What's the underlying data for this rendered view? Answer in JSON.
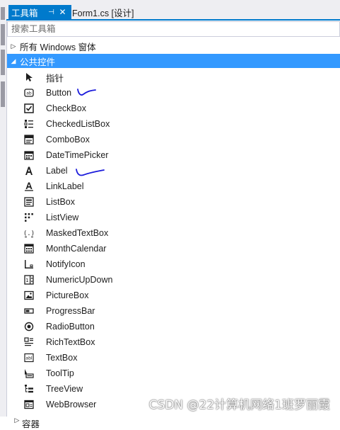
{
  "window": {
    "active_tab": "工具箱",
    "pin_glyph": "⊣",
    "close_glyph": "✕",
    "doc_tab": "Form1.cs [设计]"
  },
  "search": {
    "placeholder": "搜索工具箱"
  },
  "groups": {
    "all_windows": "所有 Windows 窗体",
    "common": "公共控件"
  },
  "items": [
    {
      "label": "指针",
      "icon": "pointer-icon"
    },
    {
      "label": "Button",
      "icon": "button-icon"
    },
    {
      "label": "CheckBox",
      "icon": "checkbox-icon"
    },
    {
      "label": "CheckedListBox",
      "icon": "checkedlistbox-icon"
    },
    {
      "label": "ComboBox",
      "icon": "combobox-icon"
    },
    {
      "label": "DateTimePicker",
      "icon": "datetimepicker-icon"
    },
    {
      "label": "Label",
      "icon": "label-icon"
    },
    {
      "label": "LinkLabel",
      "icon": "linklabel-icon"
    },
    {
      "label": "ListBox",
      "icon": "listbox-icon"
    },
    {
      "label": "ListView",
      "icon": "listview-icon"
    },
    {
      "label": "MaskedTextBox",
      "icon": "maskedtextbox-icon"
    },
    {
      "label": "MonthCalendar",
      "icon": "monthcalendar-icon"
    },
    {
      "label": "NotifyIcon",
      "icon": "notifyicon-icon"
    },
    {
      "label": "NumericUpDown",
      "icon": "numericupdown-icon"
    },
    {
      "label": "PictureBox",
      "icon": "picturebox-icon"
    },
    {
      "label": "ProgressBar",
      "icon": "progressbar-icon"
    },
    {
      "label": "RadioButton",
      "icon": "radiobutton-icon"
    },
    {
      "label": "RichTextBox",
      "icon": "richtextbox-icon"
    },
    {
      "label": "TextBox",
      "icon": "textbox-icon"
    },
    {
      "label": "ToolTip",
      "icon": "tooltip-icon"
    },
    {
      "label": "TreeView",
      "icon": "treeview-icon"
    },
    {
      "label": "WebBrowser",
      "icon": "webbrowser-icon"
    }
  ],
  "partial_item": "容器",
  "watermark": "CSDN @22计算机网络1班罗丽霞",
  "colors": {
    "accent": "#007acc",
    "selection": "#3399ff",
    "annotation_ink": "#1a1adb"
  }
}
